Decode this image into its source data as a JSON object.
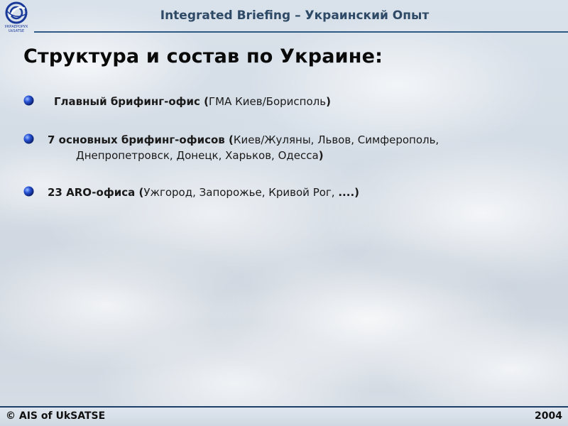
{
  "header": {
    "logo_caption_line1": "УКРАЕРОРУХ",
    "logo_caption_line2": "UkSATSE",
    "title": "Integrated Briefing – Украинский Опыт"
  },
  "slide": {
    "heading": "Структура и состав по Украине:",
    "bullets": [
      {
        "bold": "Главный брифинг-офис (",
        "normal": "ГМА Киев/Борисполь",
        "close": ")"
      },
      {
        "bold": "7 основных брифинг-офисов (",
        "normal": "Киев/Жуляны, Львов, Симферополь,",
        "normal2": "Днепропетровск, Донецк, Харьков, Одесса",
        "close": ")"
      },
      {
        "bold": "23 ARO-офиса (",
        "normal": "Ужгород, Запорожье, Кривой Рог, ",
        "bold2": "....)"
      }
    ]
  },
  "footer": {
    "left": "© AIS of UkSATSE",
    "right": "2004"
  },
  "colors": {
    "header_text": "#2e4a66",
    "rule": "#2e5a86",
    "bullet_blue": "#1a3fb8",
    "logo_blue": "#1a3a9a"
  },
  "icons": {
    "logo": "uksatse-logo-icon",
    "bullet": "blue-sphere-bullet-icon"
  }
}
